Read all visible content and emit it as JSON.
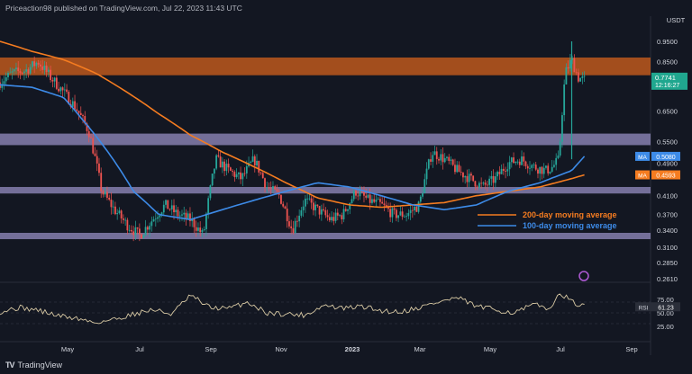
{
  "header": {
    "published": "Priceaction98 published on TradingView.com, Jul 22, 2023 11:43 UTC"
  },
  "footer": {
    "brand": "TradingView"
  },
  "colors": {
    "background": "#131722",
    "up": "#26a69a",
    "down": "#ef5350",
    "ma200": "#f57c20",
    "ma100": "#3d8be8",
    "resistance_zone": "#d4611c",
    "support_zone": "#8d86b8",
    "rsi": "#d8c9a4",
    "price_tag": "#20a78f"
  },
  "chart_data": [
    {
      "type": "line",
      "chart": "price",
      "currency_label": "USDT",
      "y_ticks": [
        "0.9500",
        "0.8500",
        "0.7741",
        "0.6500",
        "0.5500",
        "0.4900",
        "0.4100",
        "0.3700",
        "0.3400",
        "0.3100",
        "0.2850",
        "0.2610"
      ],
      "x_ticks": [
        "May",
        "Jul",
        "Sep",
        "Nov",
        "2023",
        "Mar",
        "May",
        "Jul",
        "Sep"
      ],
      "last_price": {
        "value": "0.7741",
        "countdown": "12:16:27"
      },
      "ma_tags": [
        {
          "label": "MA",
          "value": "0.5080"
        },
        {
          "label": "MA",
          "value": "0.4593"
        }
      ],
      "zones": [
        {
          "name": "resistance",
          "low": 0.79,
          "high": 0.87
        },
        {
          "name": "upper-support",
          "low": 0.54,
          "high": 0.575
        },
        {
          "name": "middle-support",
          "low": 0.415,
          "high": 0.43
        },
        {
          "name": "lower-support",
          "low": 0.325,
          "high": 0.335
        }
      ],
      "legend": [
        {
          "label": "200-day moving average",
          "color": "#f57c20"
        },
        {
          "label": "100-day moving average",
          "color": "#3d8be8"
        }
      ],
      "series": [
        {
          "name": "price",
          "x": [
            0,
            0.02,
            0.04,
            0.06,
            0.08,
            0.1,
            0.12,
            0.14,
            0.16,
            0.18,
            0.2,
            0.22,
            0.24,
            0.26,
            0.28,
            0.3,
            0.32,
            0.34,
            0.36,
            0.38,
            0.4,
            0.42,
            0.44,
            0.46,
            0.48,
            0.5,
            0.52,
            0.54,
            0.56,
            0.58,
            0.6,
            0.62,
            0.64,
            0.66,
            0.68,
            0.7,
            0.72,
            0.74,
            0.76,
            0.78,
            0.8,
            0.82,
            0.84,
            0.86,
            0.87,
            0.88,
            0.89,
            0.9,
            0.91,
            0.92
          ],
          "values": [
            0.76,
            0.8,
            0.81,
            0.85,
            0.78,
            0.72,
            0.66,
            0.58,
            0.42,
            0.38,
            0.35,
            0.33,
            0.36,
            0.39,
            0.37,
            0.36,
            0.33,
            0.5,
            0.47,
            0.45,
            0.5,
            0.43,
            0.41,
            0.34,
            0.4,
            0.38,
            0.36,
            0.37,
            0.42,
            0.4,
            0.39,
            0.37,
            0.37,
            0.39,
            0.52,
            0.5,
            0.47,
            0.45,
            0.43,
            0.45,
            0.49,
            0.5,
            0.48,
            0.47,
            0.48,
            0.5,
            0.8,
            0.86,
            0.78,
            0.77
          ]
        },
        {
          "name": "200-day moving average",
          "x": [
            0,
            0.05,
            0.1,
            0.15,
            0.2,
            0.25,
            0.3,
            0.35,
            0.4,
            0.45,
            0.5,
            0.55,
            0.6,
            0.65,
            0.7,
            0.75,
            0.8,
            0.85,
            0.9,
            0.92
          ],
          "values": [
            0.95,
            0.9,
            0.86,
            0.8,
            0.72,
            0.64,
            0.57,
            0.52,
            0.48,
            0.44,
            0.405,
            0.39,
            0.385,
            0.39,
            0.395,
            0.41,
            0.42,
            0.43,
            0.45,
            0.4593
          ]
        },
        {
          "name": "100-day moving average",
          "x": [
            0,
            0.05,
            0.1,
            0.13,
            0.17,
            0.21,
            0.25,
            0.3,
            0.35,
            0.4,
            0.45,
            0.5,
            0.55,
            0.6,
            0.65,
            0.7,
            0.75,
            0.8,
            0.85,
            0.9,
            0.92
          ],
          "values": [
            0.75,
            0.74,
            0.7,
            0.62,
            0.52,
            0.42,
            0.37,
            0.36,
            0.38,
            0.4,
            0.42,
            0.44,
            0.43,
            0.41,
            0.39,
            0.38,
            0.39,
            0.42,
            0.44,
            0.47,
            0.508
          ]
        }
      ]
    },
    {
      "type": "line",
      "chart": "rsi",
      "indicator_label": "RSI",
      "indicator_value": "61.23",
      "y_ticks": [
        "75.00",
        "50.00",
        "25.00"
      ],
      "series": [
        {
          "name": "RSI",
          "x": [
            0,
            0.03,
            0.06,
            0.09,
            0.12,
            0.15,
            0.18,
            0.21,
            0.24,
            0.27,
            0.3,
            0.33,
            0.36,
            0.39,
            0.42,
            0.45,
            0.48,
            0.51,
            0.54,
            0.57,
            0.6,
            0.63,
            0.66,
            0.69,
            0.72,
            0.75,
            0.78,
            0.81,
            0.84,
            0.87,
            0.88,
            0.9,
            0.92
          ],
          "values": [
            52,
            60,
            55,
            45,
            40,
            32,
            38,
            48,
            56,
            48,
            82,
            60,
            58,
            70,
            50,
            48,
            46,
            64,
            58,
            62,
            54,
            52,
            60,
            70,
            78,
            62,
            56,
            50,
            65,
            58,
            90,
            70,
            61
          ]
        }
      ]
    }
  ]
}
